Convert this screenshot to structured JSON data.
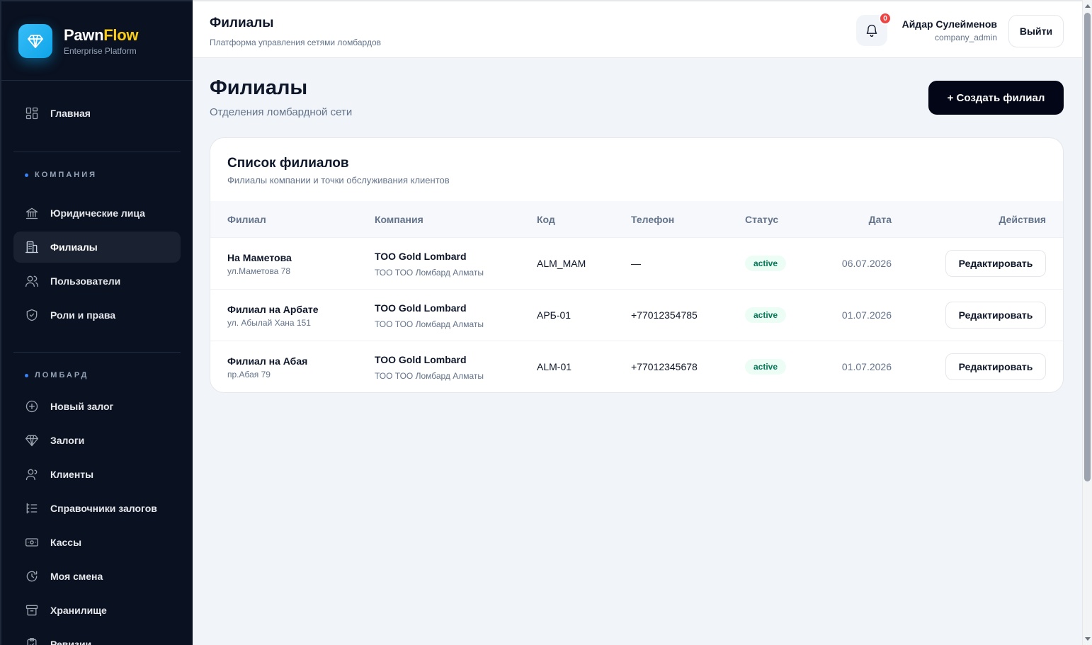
{
  "brand": {
    "name_part1": "Pawn",
    "name_part2": "Flow",
    "subtitle": "Enterprise Platform"
  },
  "sidebar": {
    "home": {
      "label": "Главная",
      "icon": "grid-icon"
    },
    "company_section": "КОМПАНИЯ",
    "company_items": [
      {
        "label": "Юридические лица",
        "icon": "bank-icon"
      },
      {
        "label": "Филиалы",
        "icon": "building-icon",
        "active": true
      },
      {
        "label": "Пользователи",
        "icon": "users-icon"
      },
      {
        "label": "Роли и права",
        "icon": "shield-icon"
      }
    ],
    "lombard_section": "ЛОМБАРД",
    "lombard_items": [
      {
        "label": "Новый залог",
        "icon": "plus-circle-icon"
      },
      {
        "label": "Залоги",
        "icon": "diamond-icon"
      },
      {
        "label": "Клиенты",
        "icon": "user-icon"
      },
      {
        "label": "Справочники залогов",
        "icon": "list-tree-icon"
      },
      {
        "label": "Кассы",
        "icon": "cash-icon"
      },
      {
        "label": "Моя смена",
        "icon": "timer-icon"
      },
      {
        "label": "Хранилище",
        "icon": "archive-icon"
      },
      {
        "label": "Ревизии",
        "icon": "clipboard-icon"
      }
    ]
  },
  "header": {
    "title": "Филиалы",
    "subtitle": "Платформа управления сетями ломбардов",
    "notifications_count": "0",
    "user_name": "Айдар Сулейменов",
    "user_role": "company_admin",
    "logout_label": "Выйти"
  },
  "main": {
    "title": "Филиалы",
    "subtitle": "Отделения ломбардной сети",
    "create_label": "+ Создать филиал"
  },
  "table": {
    "title": "Список филиалов",
    "subtitle": "Филиалы компании и точки обслуживания клиентов",
    "columns": [
      "Филиал",
      "Компания",
      "Код",
      "Телефон",
      "Статус",
      "Дата",
      "Действия"
    ],
    "edit_label": "Редактировать",
    "rows": [
      {
        "name": "На Маметова",
        "address": "ул.Маметова 78",
        "company": "ТОО Gold Lombard",
        "company_full": "ТОО ТОО Ломбард Алматы",
        "code": "ALM_MAM",
        "phone": "—",
        "status": "active",
        "date": "06.07.2026"
      },
      {
        "name": "Филиал на Арбате",
        "address": "ул. Абылай Хана 151",
        "company": "ТОО Gold Lombard",
        "company_full": "ТОО ТОО Ломбард Алматы",
        "code": "АРБ-01",
        "phone": "+77012354785",
        "status": "active",
        "date": "01.07.2026"
      },
      {
        "name": "Филиал на Абая",
        "address": "пр.Абая 79",
        "company": "ТОО Gold Lombard",
        "company_full": "ТОО ТОО Ломбард Алматы",
        "code": "ALM-01",
        "phone": "+77012345678",
        "status": "active",
        "date": "01.07.2026"
      }
    ]
  },
  "colors": {
    "sidebar_bg": "#0a1120",
    "accent": "#0ea5e9",
    "brand_yellow": "#facc15",
    "status_active": "#047857",
    "badge": "#ef4444"
  }
}
